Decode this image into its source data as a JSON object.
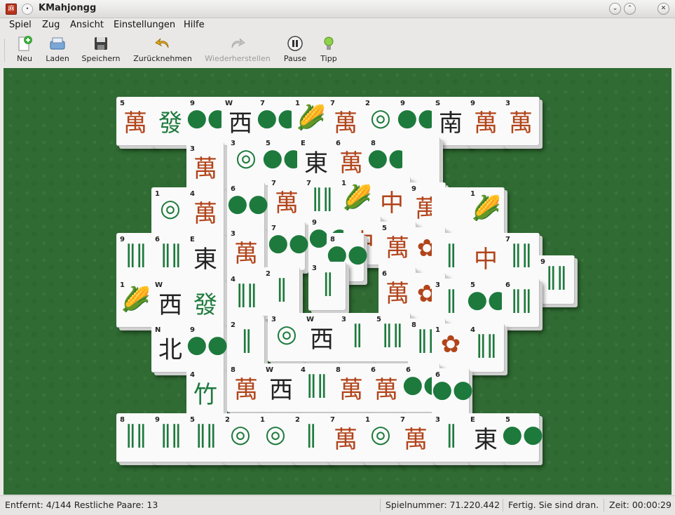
{
  "window": {
    "title": "KMahjongg",
    "icon": "mahjongg-app-icon"
  },
  "menubar": {
    "items": [
      "Spiel",
      "Zug",
      "Ansicht",
      "Einstellungen",
      "Hilfe"
    ]
  },
  "toolbar": {
    "new": "Neu",
    "load": "Laden",
    "save": "Speichern",
    "undo": "Zurücknehmen",
    "redo": "Wiederherstellen",
    "pause": "Pause",
    "hint": "Tipp"
  },
  "status": {
    "removed": "Entfernt: 4/144 Restliche Paare: 13",
    "game_number": "Spielnummer: 71.220.442",
    "message": "Fertig. Sie sind dran.",
    "time": "Zeit: 00:00:29"
  },
  "colors": {
    "board": "#2f6b32",
    "tile_face": "#fafafa",
    "character_red": "#b2441a",
    "bamboo_green": "#1d7a3c"
  },
  "tiles": [
    {
      "n": "5",
      "g": "萬",
      "c": "red"
    },
    {
      "n": "",
      "g": "發",
      "c": "green"
    },
    {
      "n": "9",
      "g": "●●",
      "c": "dots"
    },
    {
      "n": "W",
      "g": "西",
      "c": "black"
    },
    {
      "n": "7",
      "g": "●●",
      "c": "dots"
    },
    {
      "n": "1",
      "g": "🌽",
      "c": "bam"
    },
    {
      "n": "7",
      "g": "萬",
      "c": "red"
    },
    {
      "n": "2",
      "g": "◎",
      "c": "dots"
    },
    {
      "n": "9",
      "g": "●●",
      "c": "dots"
    },
    {
      "n": "S",
      "g": "南",
      "c": "black"
    },
    {
      "n": "9",
      "g": "萬",
      "c": "red"
    },
    {
      "n": "3",
      "g": "萬",
      "c": "red"
    },
    {
      "n": "3",
      "g": "萬",
      "c": "red"
    },
    {
      "n": "3",
      "g": "◎",
      "c": "dots"
    },
    {
      "n": "5",
      "g": "●●",
      "c": "dots"
    },
    {
      "n": "E",
      "g": "東",
      "c": "black"
    },
    {
      "n": "6",
      "g": "萬",
      "c": "red"
    },
    {
      "n": "8",
      "g": "●●",
      "c": "dots"
    },
    {
      "n": "",
      "g": "",
      "c": "black"
    },
    {
      "n": "1",
      "g": "◎",
      "c": "dots"
    },
    {
      "n": "4",
      "g": "萬",
      "c": "red"
    },
    {
      "n": "6",
      "g": "●●",
      "c": "dots"
    },
    {
      "n": "7",
      "g": "萬",
      "c": "red"
    },
    {
      "n": "7",
      "g": "‖‖",
      "c": "bam"
    },
    {
      "n": "1",
      "g": "🌽",
      "c": "bam"
    },
    {
      "n": "",
      "g": "中",
      "c": "red"
    },
    {
      "n": "9",
      "g": "萬",
      "c": "red"
    },
    {
      "n": "",
      "g": "",
      "c": "black"
    },
    {
      "n": "1",
      "g": "🌽",
      "c": "bam"
    },
    {
      "n": "9",
      "g": "‖‖",
      "c": "bam"
    },
    {
      "n": "6",
      "g": "‖‖",
      "c": "bam"
    },
    {
      "n": "E",
      "g": "東",
      "c": "black"
    },
    {
      "n": "3",
      "g": "萬",
      "c": "red"
    },
    {
      "n": "7",
      "g": "●●",
      "c": "dots"
    },
    {
      "n": "9",
      "g": "●●",
      "c": "dots"
    },
    {
      "n": "",
      "g": "中",
      "c": "red"
    },
    {
      "n": "5",
      "g": "萬",
      "c": "red"
    },
    {
      "n": "",
      "g": "✿",
      "c": "red"
    },
    {
      "n": "",
      "g": "‖",
      "c": "bam"
    },
    {
      "n": "",
      "g": "中",
      "c": "red"
    },
    {
      "n": "7",
      "g": "‖‖",
      "c": "bam"
    },
    {
      "n": "9",
      "g": "‖‖",
      "c": "bam"
    },
    {
      "n": "8",
      "g": "●●",
      "c": "dots"
    },
    {
      "n": "1",
      "g": "🌽",
      "c": "bam"
    },
    {
      "n": "W",
      "g": "西",
      "c": "black"
    },
    {
      "n": "",
      "g": "發",
      "c": "green"
    },
    {
      "n": "4",
      "g": "‖‖",
      "c": "bam"
    },
    {
      "n": "2",
      "g": "‖",
      "c": "bam"
    },
    {
      "n": "3",
      "g": "‖",
      "c": "bam"
    },
    {
      "n": "6",
      "g": "萬",
      "c": "red"
    },
    {
      "n": "",
      "g": "✿",
      "c": "red"
    },
    {
      "n": "3",
      "g": "‖",
      "c": "bam"
    },
    {
      "n": "5",
      "g": "●●",
      "c": "dots"
    },
    {
      "n": "6",
      "g": "‖‖",
      "c": "bam"
    },
    {
      "n": "N",
      "g": "北",
      "c": "black"
    },
    {
      "n": "9",
      "g": "●●",
      "c": "dots"
    },
    {
      "n": "2",
      "g": "‖",
      "c": "bam"
    },
    {
      "n": "3",
      "g": "◎",
      "c": "dots"
    },
    {
      "n": "W",
      "g": "西",
      "c": "black"
    },
    {
      "n": "3",
      "g": "‖",
      "c": "bam"
    },
    {
      "n": "5",
      "g": "‖‖",
      "c": "bam"
    },
    {
      "n": "8",
      "g": "‖‖",
      "c": "bam"
    },
    {
      "n": "1",
      "g": "✿",
      "c": "red"
    },
    {
      "n": "4",
      "g": "‖‖",
      "c": "bam"
    },
    {
      "n": "4",
      "g": "竹",
      "c": "green"
    },
    {
      "n": "8",
      "g": "萬",
      "c": "red"
    },
    {
      "n": "W",
      "g": "西",
      "c": "black"
    },
    {
      "n": "4",
      "g": "‖‖",
      "c": "bam"
    },
    {
      "n": "8",
      "g": "萬",
      "c": "red"
    },
    {
      "n": "6",
      "g": "萬",
      "c": "red"
    },
    {
      "n": "6",
      "g": "●●",
      "c": "dots"
    },
    {
      "n": "6",
      "g": "●●",
      "c": "dots"
    },
    {
      "n": "8",
      "g": "‖‖",
      "c": "bam"
    },
    {
      "n": "9",
      "g": "‖‖",
      "c": "bam"
    },
    {
      "n": "5",
      "g": "‖‖",
      "c": "bam"
    },
    {
      "n": "2",
      "g": "◎",
      "c": "dots"
    },
    {
      "n": "1",
      "g": "◎",
      "c": "dots"
    },
    {
      "n": "2",
      "g": "‖",
      "c": "bam"
    },
    {
      "n": "7",
      "g": "萬",
      "c": "red"
    },
    {
      "n": "1",
      "g": "◎",
      "c": "dots"
    },
    {
      "n": "7",
      "g": "萬",
      "c": "red"
    },
    {
      "n": "3",
      "g": "‖",
      "c": "bam"
    },
    {
      "n": "E",
      "g": "東",
      "c": "black"
    },
    {
      "n": "5",
      "g": "●●",
      "c": "dots"
    }
  ]
}
